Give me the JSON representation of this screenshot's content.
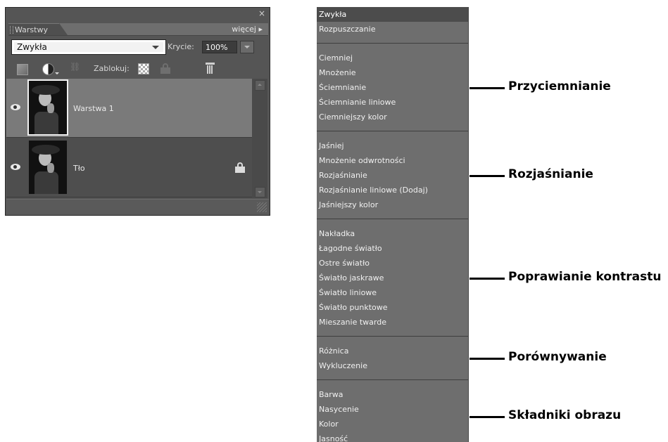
{
  "panel": {
    "close_symbol": "×",
    "tab_label": "Warstwy",
    "more_label": "więcej ▸",
    "blend_mode_value": "Zwykła",
    "opacity_label": "Krycie:",
    "opacity_value": "100%",
    "lock_label": "Zablokuj:",
    "icons": [
      "new-layer-icon",
      "adjustment-icon",
      "link-icon",
      "lock-transparency-icon",
      "lock-all-icon",
      "trash-icon"
    ],
    "layers": [
      {
        "name": "Warstwa 1",
        "selected": true,
        "locked": false
      },
      {
        "name": "Tło",
        "selected": false,
        "locked": true
      }
    ]
  },
  "menu": {
    "groups": [
      {
        "label": "",
        "items": [
          "Zwykła",
          "Rozpuszczanie"
        ]
      },
      {
        "label": "Przyciemnianie",
        "items": [
          "Ciemniej",
          "Mnożenie",
          "Ściemnianie",
          "Ściemnianie liniowe",
          "Ciemniejszy kolor"
        ]
      },
      {
        "label": "Rozjaśnianie",
        "items": [
          "Jaśniej",
          "Mnożenie odwrotności",
          "Rozjaśnianie",
          "Rozjaśnianie liniowe (Dodaj)",
          "Jaśniejszy kolor"
        ]
      },
      {
        "label": "Poprawianie kontrastu",
        "items": [
          "Nakładka",
          "Łagodne światło",
          "Ostre światło",
          "Światło jaskrawe",
          "Światło liniowe",
          "Światło punktowe",
          "Mieszanie twarde"
        ]
      },
      {
        "label": "Porównywanie",
        "items": [
          "Różnica",
          "Wykluczenie"
        ]
      },
      {
        "label": "Składniki obrazu",
        "items": [
          "Barwa",
          "Nasycenie",
          "Kolor",
          "Jasność"
        ]
      }
    ]
  }
}
